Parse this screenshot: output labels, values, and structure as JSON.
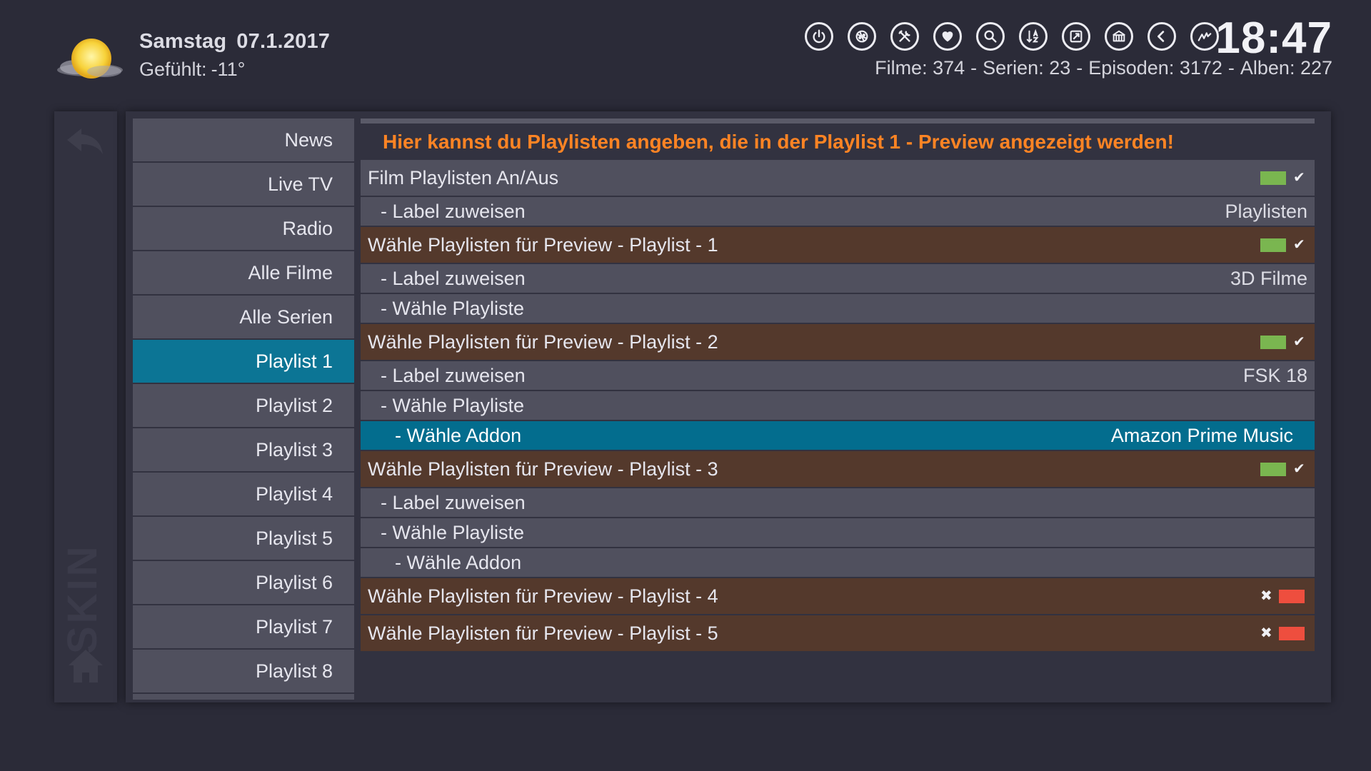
{
  "header": {
    "day": "Samstag",
    "date": "07.1.2017",
    "feels_label": "Gefühlt:",
    "feels_value": "-11°",
    "clock": "18:47",
    "stats": {
      "filme": "Filme: 374",
      "serien": "Serien: 23",
      "episoden": "Episoden: 3172",
      "alben": "Alben: 227",
      "separator": "-"
    },
    "icons": [
      "power-icon",
      "pizza-icon",
      "tools-icon",
      "heart-icon",
      "search-icon",
      "sort-az-icon",
      "screen-icon",
      "addons-icon",
      "back-circle-icon",
      "kodi-icon"
    ]
  },
  "side": {
    "label": "SKIN"
  },
  "menu": {
    "items": [
      {
        "label": "News"
      },
      {
        "label": "Live TV"
      },
      {
        "label": "Radio"
      },
      {
        "label": "Alle Filme"
      },
      {
        "label": "Alle Serien"
      },
      {
        "label": "Playlist 1"
      },
      {
        "label": "Playlist 2"
      },
      {
        "label": "Playlist 3"
      },
      {
        "label": "Playlist 4"
      },
      {
        "label": "Playlist 5"
      },
      {
        "label": "Playlist 6"
      },
      {
        "label": "Playlist 7"
      },
      {
        "label": "Playlist 8"
      }
    ],
    "active_index": 5
  },
  "content": {
    "info": "Hier kannst du Playlisten angeben, die in der Playlist 1 - Preview angezeigt werden!",
    "film_toggle": {
      "label": "Film Playlisten An/Aus",
      "state": true
    },
    "film_label": {
      "label": "- Label zuweisen",
      "value": "Playlisten"
    },
    "p1": {
      "label": "Wähle Playlisten für Preview - Playlist - 1",
      "state": true
    },
    "p1_label": {
      "label": "- Label zuweisen",
      "value": "3D Filme"
    },
    "p1_playlist": {
      "label": "- Wähle Playliste"
    },
    "p2": {
      "label": "Wähle Playlisten für Preview - Playlist - 2",
      "state": true
    },
    "p2_label": {
      "label": "- Label zuweisen",
      "value": "FSK 18"
    },
    "p2_playlist": {
      "label": "- Wähle Playliste"
    },
    "p2_addon": {
      "label": "- Wähle Addon",
      "value": "Amazon Prime Music"
    },
    "p3": {
      "label": "Wähle Playlisten für Preview - Playlist - 3",
      "state": true
    },
    "p3_label": {
      "label": "- Label zuweisen"
    },
    "p3_playlist": {
      "label": "- Wähle Playliste"
    },
    "p3_addon": {
      "label": "- Wähle Addon"
    },
    "p4": {
      "label": "Wähle Playlisten für Preview - Playlist - 4",
      "state": false
    },
    "p5": {
      "label": "Wähle Playlisten für Preview - Playlist - 5",
      "state": false
    },
    "marks": {
      "on": "✔",
      "off": "✖"
    }
  },
  "colors": {
    "accent_blue": "#0c7595",
    "header_row_brown": "#54392c",
    "info_orange": "#ff8424",
    "toggle_on": "#7ab650",
    "toggle_off": "#ee4e3e"
  }
}
